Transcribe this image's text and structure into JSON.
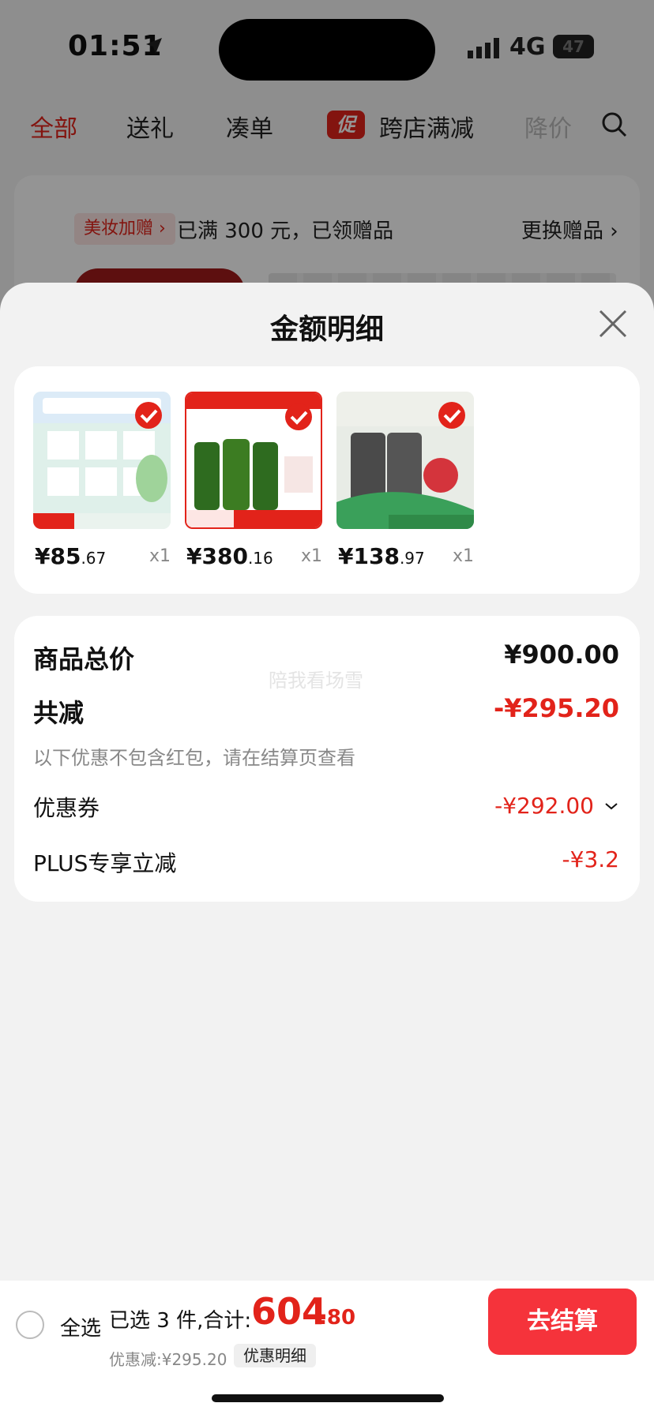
{
  "status_bar": {
    "time": "01:51",
    "network": "4G",
    "battery": "47"
  },
  "tabs": [
    {
      "label": "全部"
    },
    {
      "label": "送礼"
    },
    {
      "label": "凑单"
    },
    {
      "label": "跨店满减",
      "badge": "促"
    },
    {
      "label": "降价"
    }
  ],
  "background": {
    "gift_tag": "美妆加赠 ›",
    "gift_text": "已满 300 元，已领赠品",
    "change_gift": "更换赠品 ›"
  },
  "sheet": {
    "title": "金额明细",
    "products": [
      {
        "price_int": "¥85",
        "price_dec": ".67",
        "qty": "x1",
        "thumb_bg": "#dff0ea"
      },
      {
        "price_int": "¥380",
        "price_dec": ".16",
        "qty": "x1",
        "thumb_bg": "#ffffff"
      },
      {
        "price_int": "¥138",
        "price_dec": ".97",
        "qty": "x1",
        "thumb_bg": "#e8ece6"
      }
    ],
    "summary": {
      "watermark": "陪我看场雪",
      "total_label": "商品总价",
      "total_value": "¥900.00",
      "discount_label": "共减",
      "discount_value": "-¥295.20",
      "note": "以下优惠不包含红包，请在结算页查看",
      "coupon_label": "优惠券",
      "coupon_value": "-¥292.00",
      "plus_label": "PLUS专享立减",
      "plus_value": "-¥3.2"
    }
  },
  "bottom_bar": {
    "select_all": "全选",
    "selected_text": "已选 3 件,合计:",
    "currency": "¥",
    "total_int": "604",
    "total_dec": ".80",
    "discount_text": "优惠减:¥295.20",
    "detail_chip": "优惠明细",
    "checkout": "去结算"
  },
  "colors": {
    "accent_red": "#e2231a",
    "checkout_red": "#f5333b"
  }
}
